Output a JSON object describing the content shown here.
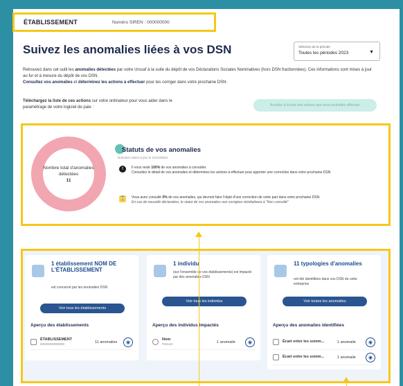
{
  "header": {
    "establishment": "ÉTABLISSEMENT",
    "siren": "Numéro SIREN : 000000000"
  },
  "title": "Suivez les anomalies liées à vos DSN",
  "period_select": {
    "label": "Sélection de la période",
    "value": "Toutes les périodes 2023"
  },
  "intro": {
    "p1_a": "Retrouvez dans cet outil les ",
    "p1_b": "anomalies détectées",
    "p1_c": " par votre Urssaf à la suite du dépôt de vos Déclarations Sociales Nominatives (hors DSN fractionnées). Ces informations sont mises à jour au fur et à mesure du dépôt de vos DSN.",
    "p2_a": "Consultez vos anomalies",
    "p2_b": " et ",
    "p2_c": "déterminez les actions à effectuer",
    "p2_d": " pour les corriger dans votre prochaine DSN."
  },
  "download": {
    "text_a": "Téléchargez la liste de ces actions",
    "text_b": " sur votre ordinateur pour vous aider dans le paramétrage de votre logiciel de paie :",
    "button": "Accéder à la liste des actions que vous souhaitez effectuer"
  },
  "statuts": {
    "title": "Statuts de vos anomalies",
    "date": "Données mises à jour le 12/12/2023",
    "donut_label": "Nombre total d'anomalies détectées",
    "donut_count": "11",
    "line1_a": "Il vous reste ",
    "line1_b": "100%",
    "line1_c": " de vos anomalies à consulter.",
    "line1_d": "Consultez le détail de vos anomalies et déterminez les actions à effectuer pour apporter une correction dans votre prochaine DSN",
    "line2_a": "Vous avez consulté ",
    "line2_b": "0%",
    "line2_c": " de vos anomalies, qui devront faire l'objet d'une correction de votre part dans votre prochaine DSN.",
    "line2_d": "En cas de nouvelle déclaration, le statut de vos anomalies non corrigées réinitialisera à \"Non consulté\""
  },
  "columns": {
    "estab": {
      "title": "1 établissement NOM DE L'ÉTABLISSEMENT",
      "desc": "est concerné par les anomalies DSN",
      "button": "Voir tous les établissements",
      "sub": "Aperçu des établissements",
      "rows": [
        {
          "name": "ÉTABLISSEMENT",
          "sub": "00000000000000",
          "count": "11 anomalies"
        }
      ]
    },
    "indiv": {
      "title": "1 individu",
      "desc": "(sur l'ensemble de vos établissements) est impacté par des anomalies DSN",
      "button": "Voir tous les individus",
      "sub": "Aperçu des individus impactés",
      "rows": [
        {
          "name": "Nom",
          "sub": "Prénom",
          "count": "1 anomalie"
        }
      ]
    },
    "typo": {
      "title": "11 typologies d'anomalies",
      "desc": "ont été identifiées dans vos DSN de cette entreprise",
      "button": "Voir toutes les anomalies",
      "sub": "Aperçu des anomalies identifiées",
      "rows": [
        {
          "name": "Écart entre les somm...",
          "count": "1 anomalie"
        },
        {
          "name": "Écart entre les somm...",
          "count": "1 anomalie"
        }
      ]
    }
  },
  "colors": {
    "highlight": "#f6c717",
    "primary": "#2a5590",
    "donut": "#f2a6b1",
    "teal": "#63c2b0"
  }
}
